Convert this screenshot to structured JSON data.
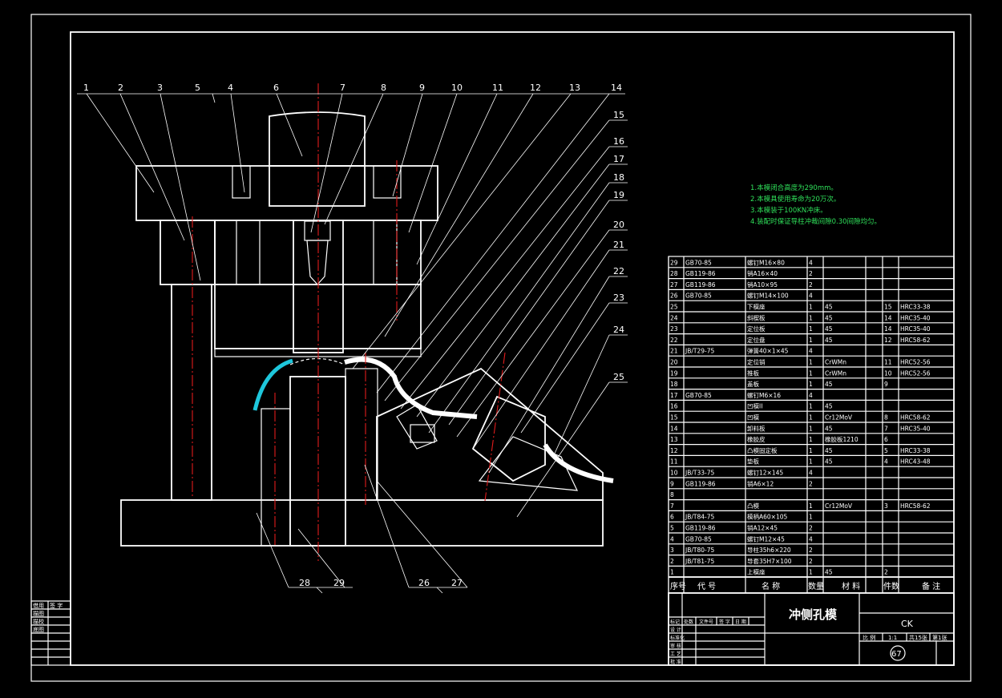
{
  "callouts_top": [
    "1",
    "2",
    "3",
    "5",
    "4",
    "6",
    "7",
    "8",
    "9",
    "10",
    "11",
    "12",
    "13",
    "14"
  ],
  "callouts_right": [
    "15",
    "16",
    "17",
    "18",
    "19",
    "20",
    "21",
    "22",
    "23",
    "24",
    "25"
  ],
  "callouts_bottom": [
    "28",
    "29",
    "26",
    "27"
  ],
  "notes": [
    "1.本模闭合高度为290mm。",
    "2.本模具使用寿命为20万次。",
    "3.本模装于100KN冲床。",
    "4.装配时保证导柱冲裁间隙0.30间隙均匀。"
  ],
  "bom": [
    [
      "29",
      "GB70-85",
      "螺钉M16×80",
      "4",
      "",
      "",
      "",
      ""
    ],
    [
      "28",
      "GB119-86",
      "销A16×40",
      "2",
      "",
      "",
      "",
      ""
    ],
    [
      "27",
      "GB119-86",
      "销A10×95",
      "2",
      "",
      "",
      "",
      ""
    ],
    [
      "26",
      "GB70-85",
      "螺钉M14×100",
      "4",
      "",
      "",
      "",
      ""
    ],
    [
      "25",
      "",
      "下模座",
      "1",
      "45",
      "",
      "15",
      "HRC33-38"
    ],
    [
      "24",
      "",
      "斜楔板",
      "1",
      "45",
      "",
      "14",
      "HRC35-40"
    ],
    [
      "23",
      "",
      "定位板",
      "1",
      "45",
      "",
      "14",
      "HRC35-40"
    ],
    [
      "22",
      "",
      "定位盘",
      "1",
      "45",
      "",
      "12",
      "HRC58-62"
    ],
    [
      "21",
      "JB/T29-75",
      "弹簧40×1×45",
      "4",
      "",
      "",
      "",
      ""
    ],
    [
      "20",
      "",
      "定位销",
      "1",
      "CrWMn",
      "",
      "11",
      "HRC52-56"
    ],
    [
      "19",
      "",
      "推板",
      "1",
      "CrWMn",
      "",
      "10",
      "HRC52-56"
    ],
    [
      "18",
      "",
      "盖板",
      "1",
      "45",
      "",
      "9",
      ""
    ],
    [
      "17",
      "GB70-85",
      "螺钉M6×16",
      "4",
      "",
      "",
      "",
      ""
    ],
    [
      "16",
      "",
      "凹模II",
      "1",
      "45",
      "",
      "",
      ""
    ],
    [
      "15",
      "",
      "凹模",
      "1",
      "Cr12MoV",
      "",
      "8",
      "HRC58-62"
    ],
    [
      "14",
      "",
      "卸料板",
      "1",
      "45",
      "",
      "7",
      "HRC35-40"
    ],
    [
      "13",
      "",
      "橡胶皮",
      "1",
      "橡胶板1210",
      "",
      "6",
      ""
    ],
    [
      "12",
      "",
      "凸模固定板",
      "1",
      "45",
      "",
      "5",
      "HRC33-38"
    ],
    [
      "11",
      "",
      "垫板",
      "1",
      "45",
      "",
      "4",
      "HRC43-48"
    ],
    [
      "10",
      "JB/T33-75",
      "螺钉12×145",
      "4",
      "",
      "",
      "",
      ""
    ],
    [
      "9",
      "GB119-86",
      "销A6×12",
      "2",
      "",
      "",
      "",
      ""
    ],
    [
      "8",
      "",
      "",
      "",
      "",
      "",
      "",
      ""
    ],
    [
      "7",
      "",
      "凸模",
      "1",
      "Cr12MoV",
      "",
      "3",
      "HRC58-62"
    ],
    [
      "6",
      "JB/T84-75",
      "模柄A60×105",
      "1",
      "",
      "",
      "",
      ""
    ],
    [
      "5",
      "GB119-86",
      "销A12×45",
      "2",
      "",
      "",
      "",
      ""
    ],
    [
      "4",
      "GB70-85",
      "螺钉M12×45",
      "4",
      "",
      "",
      "",
      ""
    ],
    [
      "3",
      "JB/T80-75",
      "导柱35h6×220",
      "2",
      "",
      "",
      "",
      ""
    ],
    [
      "2",
      "JB/T81-75",
      "导套35H7×100",
      "2",
      "",
      "",
      "",
      ""
    ],
    [
      "1",
      "",
      "上模座",
      "1",
      "45",
      "",
      "2",
      ""
    ]
  ],
  "bom_header": [
    "序号",
    "代 号",
    "名 称",
    "数量",
    "材 料",
    "件数",
    "备 注"
  ],
  "title": {
    "name": "冲侧孔模",
    "code": "CK",
    "sheet_no": "67",
    "meta": [
      "比 例",
      "1:1",
      "共15张",
      "第1张"
    ]
  },
  "left_stamp": [
    "借用",
    "签 字",
    "描图",
    "描校",
    "底图"
  ],
  "revision_rows": [
    "标记",
    "处数",
    "文件号",
    "签 字",
    "日 期",
    "设 计",
    "标准化",
    "审 核",
    "工 艺",
    "批 准"
  ]
}
